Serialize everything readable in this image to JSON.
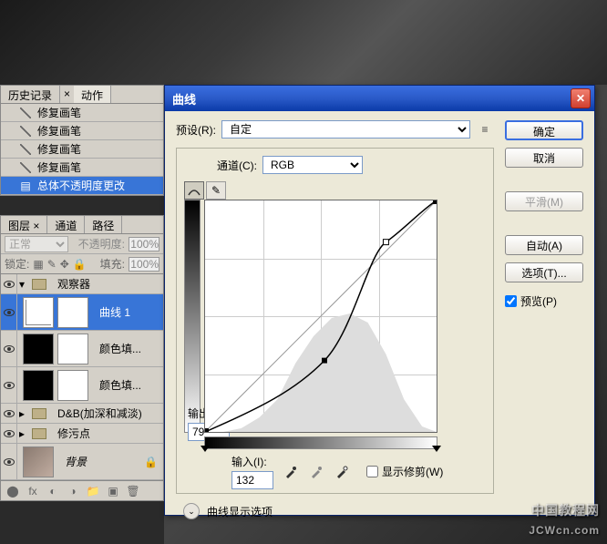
{
  "history": {
    "tab_history": "历史记录",
    "tab_actions": "动作",
    "items": [
      {
        "label": "修复画笔",
        "icon": "brush"
      },
      {
        "label": "修复画笔",
        "icon": "brush"
      },
      {
        "label": "修复画笔",
        "icon": "brush"
      },
      {
        "label": "修复画笔",
        "icon": "brush"
      },
      {
        "label": "总体不透明度更改",
        "icon": "opacity",
        "active": true
      }
    ]
  },
  "layers": {
    "tab_layers": "图层",
    "tab_channels": "通道",
    "tab_paths": "路径",
    "blend_mode": "正常",
    "opacity_label": "不透明度:",
    "opacity_value": "100%",
    "lock_label": "锁定:",
    "fill_label": "填充:",
    "fill_value": "100%",
    "items": [
      {
        "type": "group",
        "name": "观察器"
      },
      {
        "type": "adjust",
        "name": "曲线 1",
        "active": true,
        "thumb": "curves"
      },
      {
        "type": "adjust",
        "name": "颜色填...",
        "thumb": "black"
      },
      {
        "type": "adjust",
        "name": "颜色填...",
        "thumb": "black"
      },
      {
        "type": "group",
        "name": "D&B(加深和减淡)"
      },
      {
        "type": "group",
        "name": "修污点"
      },
      {
        "type": "bg",
        "name": "背景"
      }
    ]
  },
  "dialog": {
    "title": "曲线",
    "preset_label": "预设(R):",
    "preset_value": "自定",
    "channel_label": "通道(C):",
    "channel_value": "RGB",
    "output_label": "输出(O):",
    "output_value": "79",
    "input_label": "输入(I):",
    "input_value": "132",
    "show_clip": "显示修剪(W)",
    "expand_label": "曲线显示选项",
    "btn_ok": "确定",
    "btn_cancel": "取消",
    "btn_smooth": "平滑(M)",
    "btn_auto": "自动(A)",
    "btn_options": "选项(T)...",
    "chk_preview": "预览(P)"
  },
  "chart_data": {
    "type": "line",
    "title": "曲线",
    "xlabel": "输入",
    "ylabel": "输出",
    "xlim": [
      0,
      255
    ],
    "ylim": [
      0,
      255
    ],
    "series": [
      {
        "name": "baseline",
        "x": [
          0,
          255
        ],
        "y": [
          0,
          255
        ]
      },
      {
        "name": "curve",
        "x": [
          0,
          132,
          200,
          255
        ],
        "y": [
          0,
          79,
          210,
          255
        ]
      }
    ],
    "control_points": [
      {
        "x": 0,
        "y": 0
      },
      {
        "x": 132,
        "y": 79
      },
      {
        "x": 200,
        "y": 210
      },
      {
        "x": 255,
        "y": 255
      }
    ]
  },
  "watermark": {
    "cn": "中国教程网",
    "en": "JCWcn.com"
  }
}
